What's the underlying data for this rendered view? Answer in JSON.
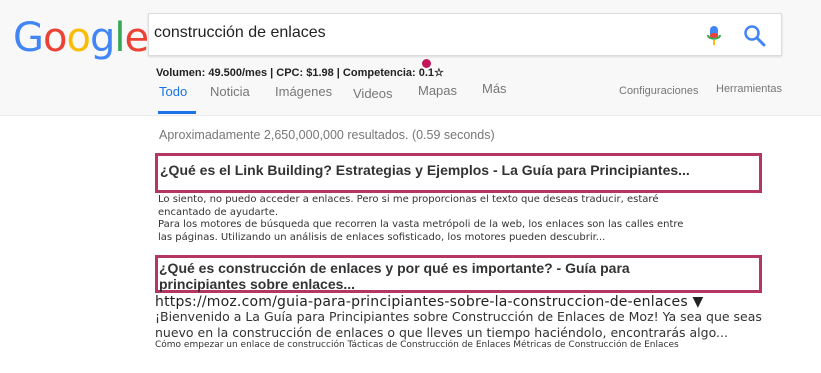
{
  "logo": {
    "text": "Google",
    "letters": [
      {
        "char": "G",
        "color": "#4285F4"
      },
      {
        "char": "o",
        "color": "#EA4335"
      },
      {
        "char": "o",
        "color": "#FBBC05"
      },
      {
        "char": "g",
        "color": "#4285F4"
      },
      {
        "char": "l",
        "color": "#34A853"
      },
      {
        "char": "e",
        "color": "#EA4335"
      }
    ]
  },
  "search": {
    "query": "construcción de enlaces"
  },
  "metrics": {
    "text": "Volumen: 49.500/mes | CPC: $1.98 | Competencia: 0.1☆"
  },
  "tabs": [
    {
      "label": "Todo",
      "active": true
    },
    {
      "label": "Noticia",
      "active": false
    },
    {
      "label": "Imágenes",
      "active": false
    },
    {
      "label": "Videos",
      "active": false
    },
    {
      "label": "Mapas",
      "active": false
    },
    {
      "label": "Más",
      "active": false
    }
  ],
  "tools": {
    "settings": "Configuraciones",
    "tools": "Herramientas"
  },
  "stats": "Aproximadamente 2,650,000,000 resultados. (0.59 seconds)",
  "results": [
    {
      "title": "¿Qué es el Link Building? Estrategias y Ejemplos - La Guía para Principiantes...",
      "snippet": [
        "Lo siento, no puedo acceder a enlaces. Pero si me proporcionas el texto que deseas traducir, estaré",
        "encantado de ayudarte.",
        "Para los motores de búsqueda que recorren la vasta metrópoli de la web, los enlaces son las calles entre",
        "las páginas. Utilizando un análisis de enlaces sofisticado, los motores pueden descubrir..."
      ]
    },
    {
      "title_lines": [
        "¿Qué es construcción de enlaces y por qué es importante? - Guía para",
        "principiantes sobre enlaces..."
      ],
      "url": "https://moz.com/guia-para-principiantes-sobre-la-construccion-de-enlaces ▼",
      "snippet": [
        "¡Bienvenido a La Guía para Principiantes sobre Construcción de Enlaces de Moz! Ya sea que seas",
        "nuevo en la construcción de enlaces o que lleves un tiempo haciéndolo, encontrarás algo..."
      ],
      "sitelinks": "Cómo empezar un enlace de construcción Tácticas de Construcción de Enlaces Métricas de Construcción de Enlaces"
    }
  ]
}
